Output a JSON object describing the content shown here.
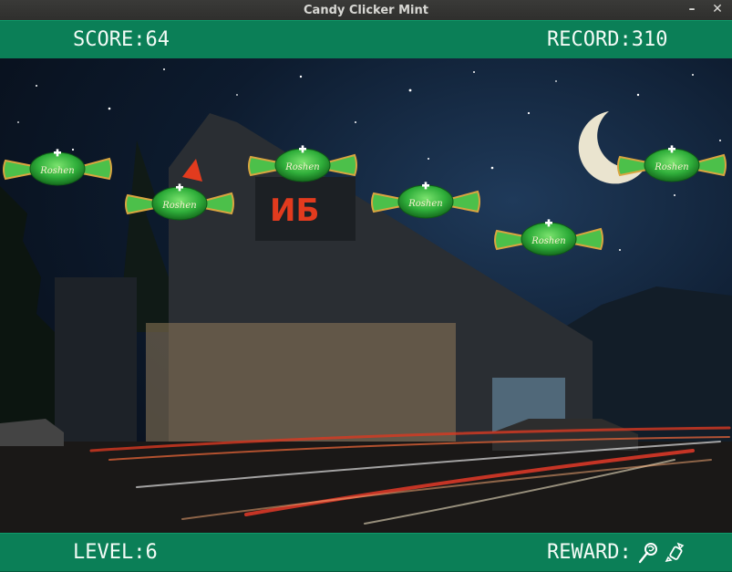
{
  "window": {
    "title": "Candy Clicker Mint"
  },
  "hud": {
    "score_label": "SCORE:",
    "score_value": "64",
    "record_label": "RECORD:",
    "record_value": "310",
    "level_label": "LEVEL:",
    "level_value": "6",
    "reward_label": "REWARD:"
  },
  "store_sign": "ИБ",
  "candy_wrapper_text": "Roshen",
  "colors": {
    "hud_bar": "#0b7f57",
    "candy_green": "#2fae3a",
    "wrapper_gold": "#e2b04a"
  },
  "icons": [
    "lollipop-icon",
    "wrapped-candy-icon",
    "close-icon",
    "minimize-icon"
  ]
}
